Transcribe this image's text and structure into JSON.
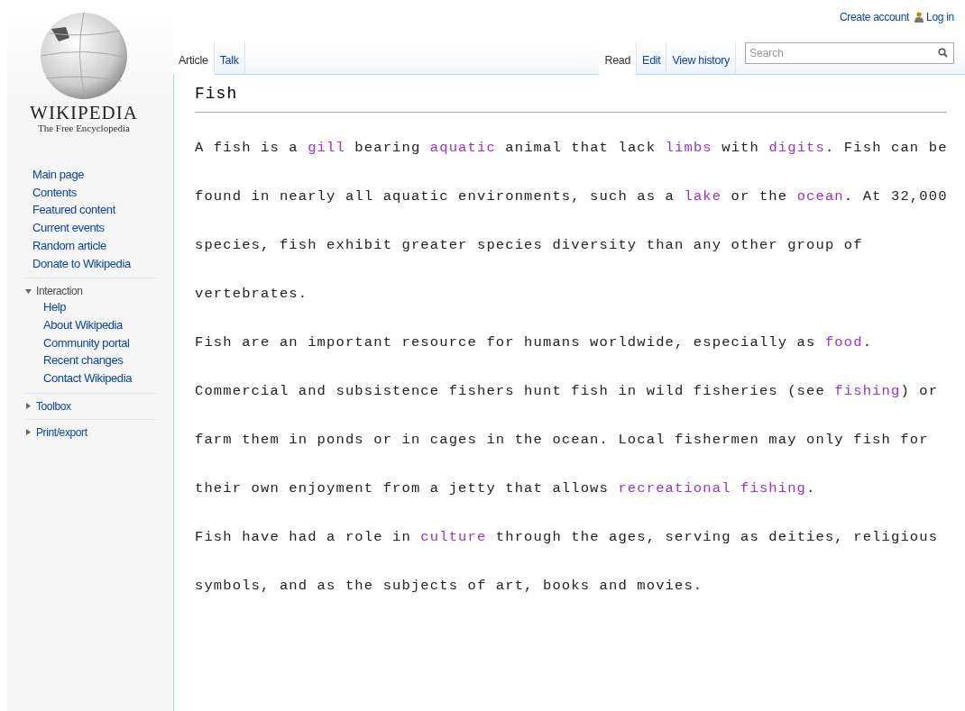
{
  "logo": {
    "wordmark": "WIKIPEDIA",
    "tagline": "The Free Encyclopedia"
  },
  "personal": {
    "create_account": "Create account",
    "log_in": "Log in"
  },
  "navigation": [
    "Main page",
    "Contents",
    "Featured content",
    "Current events",
    "Random article",
    "Donate to Wikipedia"
  ],
  "portals": [
    {
      "title": "Interaction",
      "expanded": true,
      "items": [
        "Help",
        "About Wikipedia",
        "Community portal",
        "Recent changes",
        "Contact Wikipedia"
      ]
    },
    {
      "title": "Toolbox",
      "expanded": false
    },
    {
      "title": "Print/export",
      "expanded": false
    }
  ],
  "namespace_tabs": [
    {
      "label": "Article",
      "selected": true
    },
    {
      "label": "Talk",
      "selected": false
    }
  ],
  "view_tabs": [
    {
      "label": "Read",
      "selected": true
    },
    {
      "label": "Edit",
      "selected": false
    },
    {
      "label": "View history",
      "selected": false
    }
  ],
  "search": {
    "placeholder": "Search"
  },
  "article": {
    "title": "Fish",
    "paragraphs": [
      [
        {
          "kind": "text",
          "text": "A fish is a "
        },
        {
          "kind": "link",
          "text": "gill"
        },
        {
          "kind": "text",
          "text": " bearing "
        },
        {
          "kind": "link",
          "text": "aquatic"
        },
        {
          "kind": "text",
          "text": " animal that lack "
        },
        {
          "kind": "link",
          "text": "limbs"
        },
        {
          "kind": "text",
          "text": " with "
        },
        {
          "kind": "link",
          "text": "digits"
        },
        {
          "kind": "text",
          "text": ". Fish can be found in nearly all aquatic environments, such as a "
        },
        {
          "kind": "link",
          "text": "lake"
        },
        {
          "kind": "text",
          "text": " or the "
        },
        {
          "kind": "link",
          "text": "ocean"
        },
        {
          "kind": "text",
          "text": ". At 32,000 species, fish exhibit greater species diversity than any other group of vertebrates."
        }
      ],
      [
        {
          "kind": "text",
          "text": "Fish are an important resource for humans worldwide, especially as "
        },
        {
          "kind": "link",
          "text": "food"
        },
        {
          "kind": "text",
          "text": ". Commercial and subsistence fishers hunt fish in wild fisheries (see "
        },
        {
          "kind": "link",
          "text": "fishing"
        },
        {
          "kind": "text",
          "text": ") or farm them in ponds or in cages in the ocean. Local fishermen may only fish for their own enjoyment from a jetty that allows "
        },
        {
          "kind": "link",
          "text": "recreational fishing"
        },
        {
          "kind": "text",
          "text": "."
        }
      ],
      [
        {
          "kind": "text",
          "text": "Fish have had a role in "
        },
        {
          "kind": "link",
          "text": "culture"
        },
        {
          "kind": "text",
          "text": " through the ages, serving as deities, religious symbols, and as the subjects of art, books and movies."
        }
      ]
    ]
  }
}
